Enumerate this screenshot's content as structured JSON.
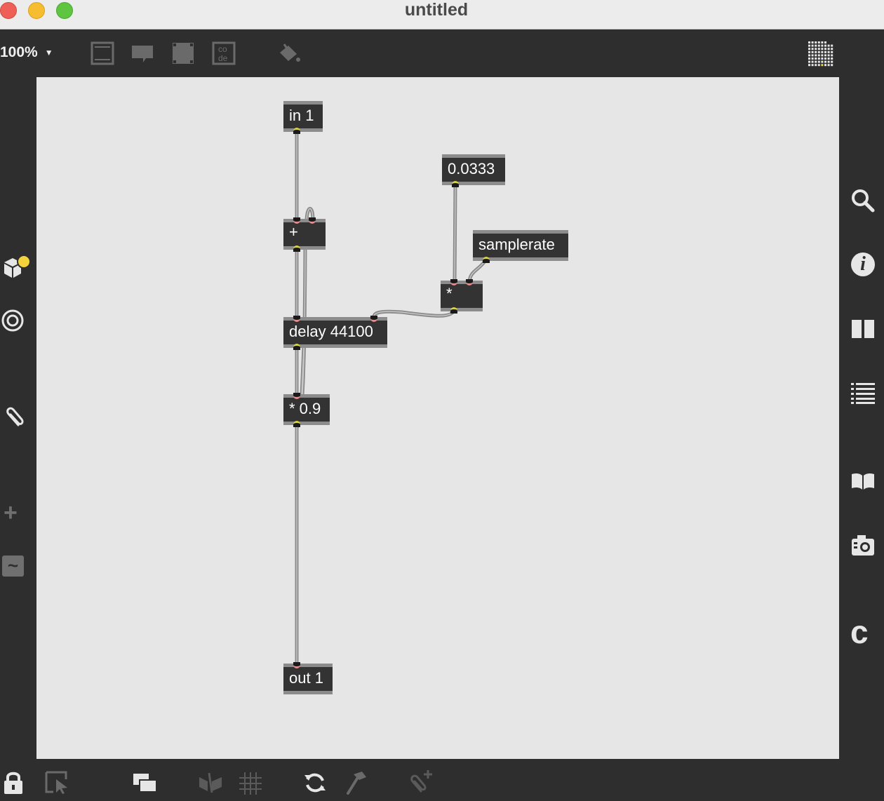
{
  "window": {
    "title": "untitled"
  },
  "toolbar": {
    "zoom_label": "100%",
    "icons": [
      "presentation-icon",
      "comment-icon",
      "inspector-box-icon",
      "code-icon",
      "paint-bucket-icon",
      "grid-palette-icon"
    ],
    "code_icon_text_top": "co",
    "code_icon_text_bottom": "de"
  },
  "patch": {
    "objects": {
      "in1": {
        "label": "in 1"
      },
      "plus": {
        "label": "+"
      },
      "const": {
        "label": "0.0333"
      },
      "samplerate": {
        "label": "samplerate"
      },
      "mult": {
        "label": "*"
      },
      "delay": {
        "label": "delay 44100"
      },
      "gain": {
        "label": "* 0.9"
      },
      "out1": {
        "label": "out 1"
      }
    }
  },
  "left_sidebar": {
    "icons": [
      "package-icon",
      "target-icon",
      "paperclip-icon",
      "plus-icon",
      "tilde-icon"
    ],
    "plus_glyph": "+",
    "tilde_glyph": "~"
  },
  "right_sidebar": {
    "icons": [
      "search-icon",
      "info-icon",
      "columns-icon",
      "list-icon",
      "book-icon",
      "camera-icon",
      "c-icon"
    ],
    "info_glyph": "i",
    "c_glyph": "c"
  },
  "bottom_bar": {
    "icons": [
      "lock-icon",
      "select-cursor-icon",
      "windows-icon",
      "hide-icon",
      "grid-icon",
      "refresh-icon",
      "hammer-icon",
      "add-attachment-icon"
    ]
  },
  "colors": {
    "canvas": "#e6e6e6",
    "object_body": "#333333",
    "inlet": "#e38e8e",
    "outlet": "#d9d34a",
    "cord": "#8a8a8a",
    "accent_dot": "#f3d23b"
  }
}
